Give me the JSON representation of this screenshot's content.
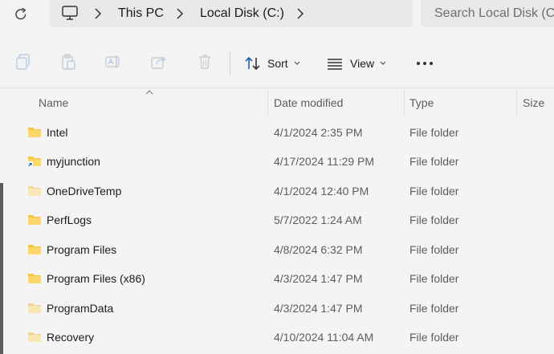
{
  "address_bar": {
    "breadcrumb": [
      "This PC",
      "Local Disk (C:)"
    ],
    "search_placeholder": "Search Local Disk (C:)",
    "icons": [
      "refresh-icon",
      "this-pc-icon",
      "chevron-right-icon"
    ]
  },
  "command_bar": {
    "actions": [
      "copy-icon",
      "paste-icon",
      "rename-icon",
      "share-icon",
      "delete-icon"
    ],
    "sort_label": "Sort",
    "view_label": "View",
    "more_icon": "more-icon"
  },
  "columns": {
    "name": "Name",
    "date_modified": "Date modified",
    "type": "Type",
    "size": "Size"
  },
  "files": [
    {
      "name": "Intel",
      "date": "4/1/2024 2:35 PM",
      "type": "File folder",
      "icon": "folder-icon"
    },
    {
      "name": "myjunction",
      "date": "4/17/2024 11:29 PM",
      "type": "File folder",
      "icon": "folder-shortcut-icon"
    },
    {
      "name": "OneDriveTemp",
      "date": "4/1/2024 12:40 PM",
      "type": "File folder",
      "icon": "folder-hidden-icon"
    },
    {
      "name": "PerfLogs",
      "date": "5/7/2022 1:24 AM",
      "type": "File folder",
      "icon": "folder-icon"
    },
    {
      "name": "Program Files",
      "date": "4/8/2024 6:32 PM",
      "type": "File folder",
      "icon": "folder-icon"
    },
    {
      "name": "Program Files (x86)",
      "date": "4/3/2024 1:47 PM",
      "type": "File folder",
      "icon": "folder-icon"
    },
    {
      "name": "ProgramData",
      "date": "4/3/2024 1:47 PM",
      "type": "File folder",
      "icon": "folder-hidden-icon"
    },
    {
      "name": "Recovery",
      "date": "4/10/2024 11:04 AM",
      "type": "File folder",
      "icon": "folder-hidden-icon"
    }
  ],
  "colors": {
    "folder": "#f9c440",
    "folder_hidden": "#f6dfa2",
    "shortcut_arrow": "#1a5fb4",
    "text_secondary": "#5d5d5d"
  }
}
